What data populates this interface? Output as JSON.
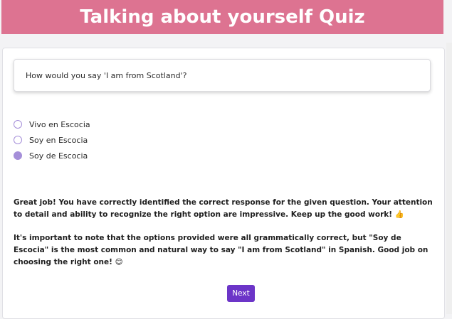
{
  "header": {
    "title": "Talking about yourself Quiz"
  },
  "question": {
    "text": "How would you say 'I am from Scotland'?"
  },
  "options": [
    {
      "label": "Vivo en Escocia",
      "selected": false
    },
    {
      "label": "Soy en Escocia",
      "selected": false
    },
    {
      "label": "Soy de Escocia",
      "selected": true
    }
  ],
  "feedback": {
    "paragraph1": "Great job! You have correctly identified the correct response for the given question. Your attention to detail and ability to recognize the right option are impressive. Keep up the good work! 👍",
    "paragraph2": "It's important to note that the options provided were all grammatically correct, but \"Soy de Escocia\" is the most common and natural way to say \"I am from Scotland\" in Spanish. Good job on choosing the right one! 😊"
  },
  "next_button": {
    "label": "Next"
  },
  "colors": {
    "header": "#dd7391",
    "accent": "#6c35c8",
    "radio": "#a58fd9"
  }
}
